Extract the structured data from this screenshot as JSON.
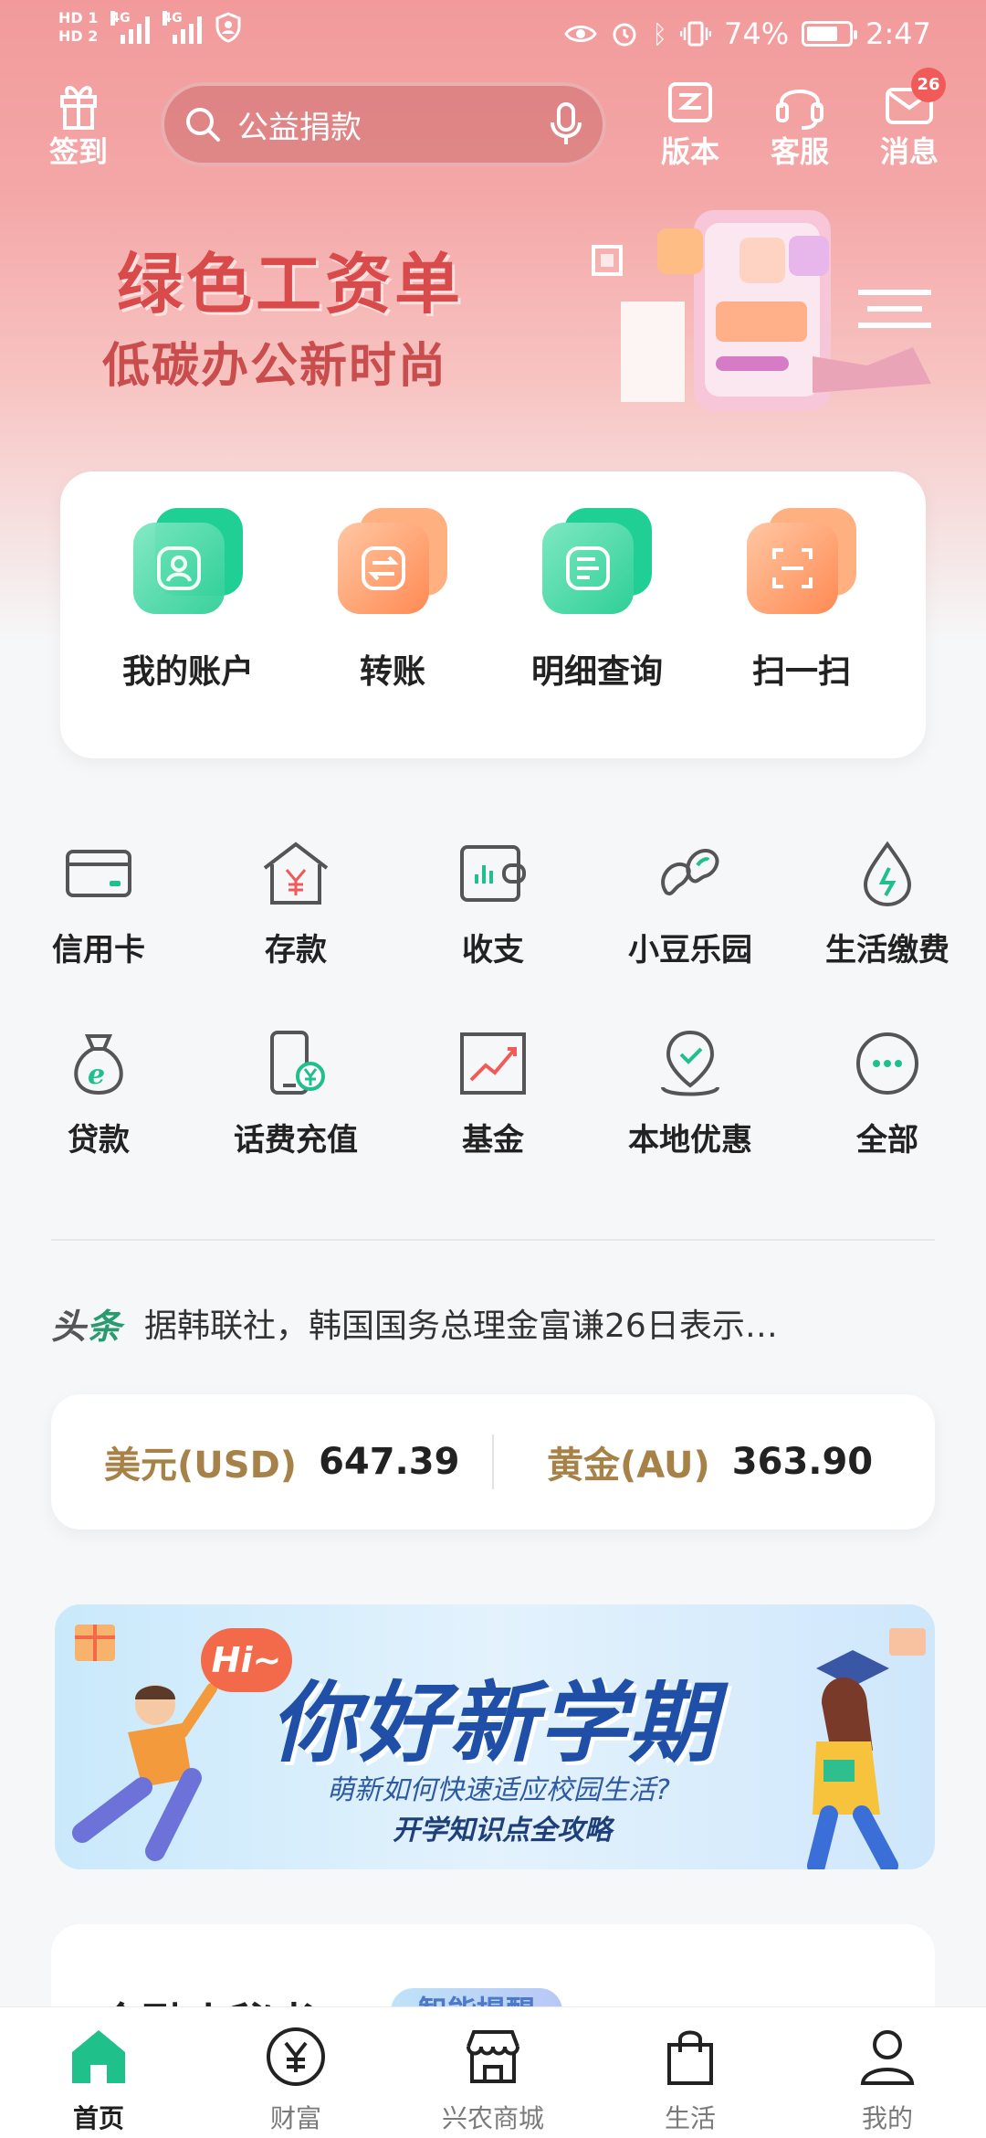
{
  "status_bar": {
    "hd1": "HD 1",
    "hd2": "HD 2",
    "net1": "4G",
    "net2": "4G",
    "battery_pct": "74%",
    "battery_level": 0.74,
    "time": "2:47"
  },
  "header": {
    "checkin_label": "签到",
    "search_placeholder": "公益捐款",
    "version_label": "版本",
    "service_label": "客服",
    "message_label": "消息",
    "message_badge": "26"
  },
  "banner": {
    "title": "绿色工资单",
    "subtitle": "低碳办公新时尚"
  },
  "main_actions": [
    {
      "label": "我的账户"
    },
    {
      "label": "转账"
    },
    {
      "label": "明细查询"
    },
    {
      "label": "扫一扫"
    }
  ],
  "grid": [
    {
      "label": "信用卡"
    },
    {
      "label": "存款"
    },
    {
      "label": "收支"
    },
    {
      "label": "小豆乐园"
    },
    {
      "label": "生活缴费"
    },
    {
      "label": "贷款"
    },
    {
      "label": "话费充值"
    },
    {
      "label": "基金"
    },
    {
      "label": "本地优惠"
    },
    {
      "label": "全部"
    }
  ],
  "news": {
    "tag_a": "头",
    "tag_b": "条",
    "text": "据韩联社，韩国国务总理金富谦26日表示…"
  },
  "rates": [
    {
      "name": "美元(USD)",
      "value": "647.39"
    },
    {
      "name": "黄金(AU)",
      "value": "363.90"
    }
  ],
  "promo": {
    "hi": "Hi~",
    "title": "你好新学期",
    "sub1": "萌新如何快速适应校园生活?",
    "sub2": "开学知识点全攻略"
  },
  "next_section": {
    "title": "金融小秘书",
    "tag": "智能提醒"
  },
  "bottom_nav": [
    {
      "label": "首页"
    },
    {
      "label": "财富"
    },
    {
      "label": "兴农商城"
    },
    {
      "label": "生活"
    },
    {
      "label": "我的"
    }
  ],
  "colors": {
    "brand_green": "#20c08a",
    "brand_orange": "#ff8a54",
    "header_pink": "#f29a9b",
    "rate_gold": "#a78248"
  }
}
